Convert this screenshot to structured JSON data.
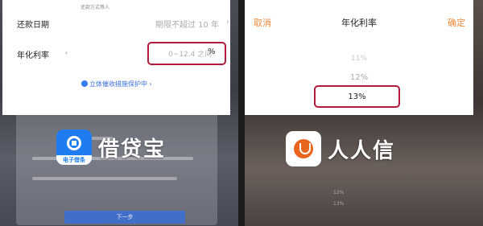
{
  "left": {
    "header_small": "还款方式等人",
    "repay_label": "还款日期",
    "repay_value": "期限不超过 10 年",
    "rate_label": "年化利率",
    "rate_placeholder": "0~12.4 之间",
    "rate_unit": "%",
    "protect_text": "立体催收措施保护中",
    "bg_button": "下一步",
    "brand_tag": "电子借条",
    "brand_name": "借贷宝"
  },
  "right": {
    "cancel": "取消",
    "title": "年化利率",
    "confirm": "确定",
    "options": [
      "11%",
      "12%",
      "13%"
    ],
    "selected": "13%",
    "ghost_options": [
      "12%",
      "13%"
    ],
    "brand_name": "人人信"
  },
  "colors": {
    "accent_orange": "#f08a3c",
    "highlight_red": "#b01c3c",
    "brand_blue": "#1e7cf0",
    "brand_orange": "#e8651e"
  }
}
